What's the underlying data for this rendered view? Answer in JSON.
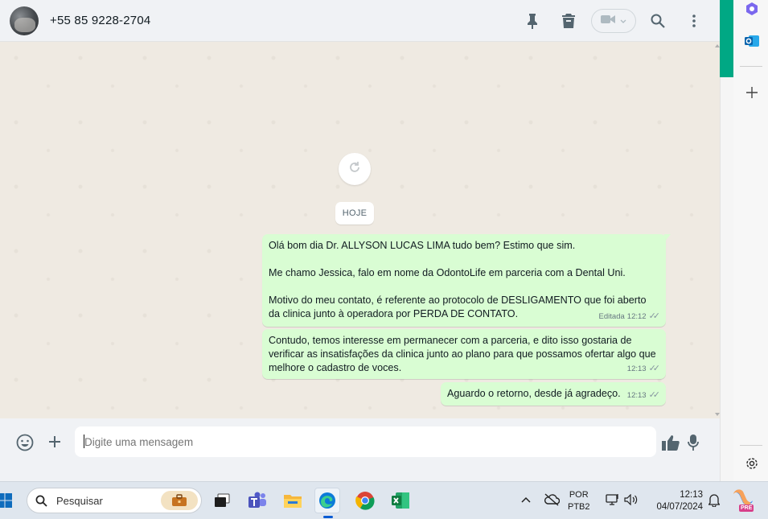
{
  "header": {
    "contact_name": "+55 85 9228-2704"
  },
  "chat": {
    "date_chip": "HOJE",
    "messages": [
      {
        "text": "Olá bom dia Dr. ALLYSON LUCAS LIMA tudo bem? Estimo que sim.\n\nMe chamo Jessica, falo em nome da OdontoLife em parceria com a Dental Uni.\n\nMotivo do meu contato, é referente ao protocolo de DESLIGAMENTO que foi aberto\nda clinica junto à operadora por PERDA DE CONTATO.",
        "edited_label": "Editada",
        "time": "12:12",
        "ticks": "✓✓"
      },
      {
        "text": "Contudo, temos interesse em permanecer com a parceria, e dito isso gostaria de\nverificar as insatisfações da clinica junto ao plano para que possamos ofertar algo que\nmelhore o cadastro de voces.",
        "time": "12:13",
        "ticks": "✓✓"
      },
      {
        "text": "Aguardo o retorno, desde já agradeço.",
        "time": "12:13",
        "ticks": "✓✓"
      }
    ]
  },
  "composer": {
    "placeholder": "Digite uma mensagem"
  },
  "taskbar": {
    "search_placeholder": "Pesquisar",
    "language_line1": "POR",
    "language_line2": "PTB2",
    "time": "12:13",
    "date": "04/07/2024",
    "copilot_badge": "PRE"
  },
  "colors": {
    "outgoing_bubble": "#d9fdd3",
    "chat_background": "#efeae2",
    "accent": "#00a884"
  },
  "icons": {
    "header": [
      "pin-icon",
      "trash-icon",
      "video-icon",
      "search-icon",
      "more-vertical-icon"
    ],
    "composer": [
      "emoji-icon",
      "plus-icon",
      "thumbs-up-icon",
      "microphone-icon"
    ],
    "rail": [
      "copilot-icon",
      "outlook-icon",
      "add-icon",
      "settings-icon"
    ]
  }
}
